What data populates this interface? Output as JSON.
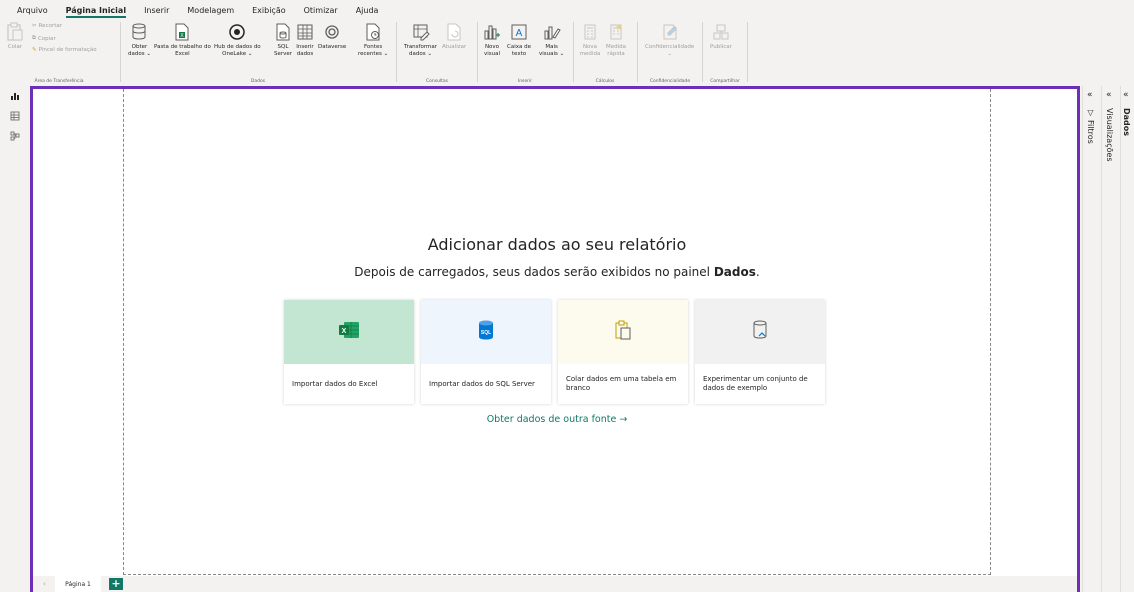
{
  "menu": {
    "items": [
      "Arquivo",
      "Página Inicial",
      "Inserir",
      "Modelagem",
      "Exibição",
      "Otimizar",
      "Ajuda"
    ],
    "active_index": 1
  },
  "ribbon": {
    "clipboard": {
      "paste": "Colar",
      "cut": "Recortar",
      "copy": "Copiar",
      "format_painter": "Pincel de formatação",
      "group": "Área de Transferência"
    },
    "data": {
      "get_data_1": "Obter",
      "get_data_2": "dados ⌄",
      "excel_1": "Pasta de trabalho do",
      "excel_2": "Excel",
      "onelake_1": "Hub de dados do",
      "onelake_2": "OneLake ⌄",
      "sql_1": "SQL",
      "sql_2": "Server",
      "enter_1": "Inserir",
      "enter_2": "dados",
      "dataverse_1": "Dataverse",
      "dataverse_2": "",
      "recent_1": "Fontes",
      "recent_2": "recentes ⌄",
      "group": "Dados"
    },
    "queries": {
      "transform_1": "Transformar",
      "transform_2": "dados ⌄",
      "refresh_1": "Atualizar",
      "refresh_2": "",
      "group": "Consultas"
    },
    "insert": {
      "new_visual_1": "Novo",
      "new_visual_2": "visual",
      "textbox_1": "Caixa de",
      "textbox_2": "texto",
      "more_1": "Mais",
      "more_2": "visuais ⌄",
      "group": "Inserir"
    },
    "calculations": {
      "new_measure_1": "Nova",
      "new_measure_2": "medida",
      "quick_measure_1": "Medida",
      "quick_measure_2": "rápida",
      "group": "Cálculos"
    },
    "sensitivity": {
      "label_1": "Confidencialidade",
      "label_2": "⌄",
      "group": "Confidencialidade"
    },
    "share": {
      "publish": "Publicar",
      "group": "Compartilhar"
    }
  },
  "canvas": {
    "headline": "Adicionar dados ao seu relatório",
    "sub_prefix": "Depois de carregados, seus dados serão exibidos no painel ",
    "sub_bold": "Dados",
    "sub_suffix": ".",
    "cards": [
      {
        "label": "Importar dados do Excel",
        "icon": "excel-icon",
        "bg": "#c3e6d3"
      },
      {
        "label": "Importar dados do SQL Server",
        "icon": "sql-server-icon",
        "bg": "#eef5fc"
      },
      {
        "label": "Colar dados em uma tabela em branco",
        "icon": "paste-icon",
        "bg": "#fdfbee"
      },
      {
        "label": "Experimentar um conjunto de dados de exemplo",
        "icon": "sample-data-icon",
        "bg": "#f1f1f1"
      }
    ],
    "other_source": "Obter dados de outra fonte →"
  },
  "pages": {
    "tab": "Página 1",
    "add": "+"
  },
  "panes": {
    "filters": "Filtros",
    "visualizations": "Visualizações",
    "data": "Dados",
    "collapse": "«"
  },
  "colors": {
    "accent": "#117865",
    "focus_border": "#6d2fb5",
    "excel_green": "#107c41",
    "sql_blue": "#0078d4"
  }
}
